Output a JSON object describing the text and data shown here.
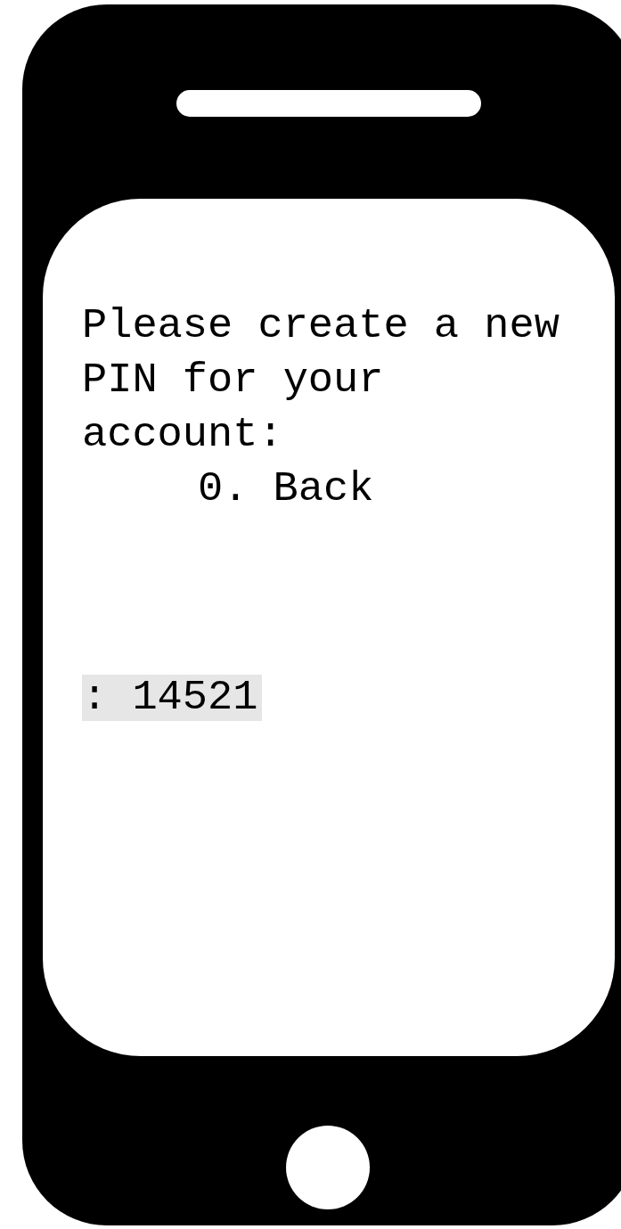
{
  "prompt": "Please create a new PIN for your account:",
  "options": [
    {
      "label": "0. Back"
    }
  ],
  "input": {
    "value": ": 14521"
  }
}
